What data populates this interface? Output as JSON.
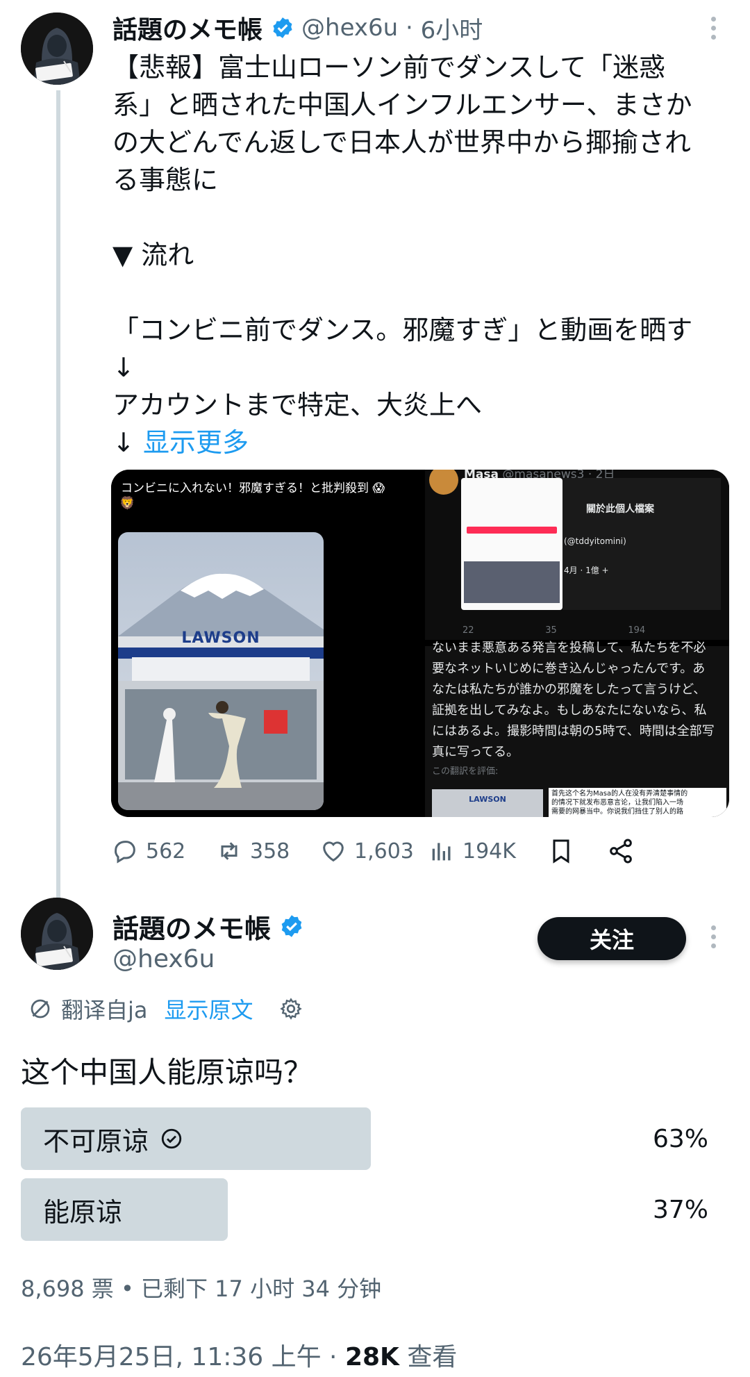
{
  "quoted_tweet": {
    "author_name": "話題のメモ帳",
    "handle": "@hex6u",
    "time_ago": "6小时",
    "text_lines": [
      "【悲報】富士山ローソン前でダンスして「迷惑",
      "系」と晒された中国人インフルエンサー、まさか",
      "の大どんでん返しで日本人が世界中から揶揄され",
      "る事態に"
    ],
    "flow_heading": "▼ 流れ",
    "flow_lines": [
      "「コンビニ前でダンス。邪魔すぎ」と動画を晒す",
      "↓",
      "アカウントまで特定、大炎上へ"
    ],
    "show_more_arrow": "↓",
    "show_more": "显示更多",
    "media": {
      "left_caption": "コンビニに入れない！邪魔すぎる！と批判殺到",
      "store_sign": "LAWSON",
      "top_right_user": "Masa",
      "top_right_handle": "@masanews3 · 2日",
      "profile_title": "關於此個人檔案",
      "profile_handle": "(@tddyitomini)",
      "profile_date": "4月 · 1億 +",
      "top_right_stats": [
        "22",
        "35",
        "194"
      ],
      "bottom_right_lines": [
        "ないまま悪意ある発言を投稿して、私たちを不必",
        "要なネットいじめに巻き込んじゃったんです。あ",
        "なたは私たちが誰かの邪魔をしたって言うけど、",
        "証拠を出してみなよ。もしあなたにないなら、私",
        "にはあるよ。撮影時間は朝の5時で、時間は全部写",
        "真に写ってる。"
      ],
      "rate_translation": "この翻訳を評価:",
      "bottom_store_sign": "LAWSON",
      "chinese_note_lines": [
        "首先这个名为Masa的人在没有弄清楚事情的",
        "的情况下就发布恶意言论，让我们陷入一场",
        "需要的网暴当中。你说我们挡住了别人的路"
      ]
    },
    "actions": {
      "replies": "562",
      "reposts": "358",
      "likes": "1,603",
      "views": "194K"
    }
  },
  "main_tweet": {
    "author_name": "話題のメモ帳",
    "handle": "@hex6u",
    "follow_label": "关注",
    "translated_from": "翻译自ja",
    "show_original": "显示原文",
    "question": "这个中国人能原谅吗？",
    "poll": {
      "options": [
        {
          "label": "不可原谅",
          "percent": "63%",
          "fraction": 0.63,
          "selected": true
        },
        {
          "label": "能原谅",
          "percent": "37%",
          "fraction": 0.37,
          "selected": false
        }
      ],
      "meta": "8,698 票 • 已剩下 17 小时 34 分钟"
    },
    "timestamp": "26年5月25日, 11:36 上午 · ",
    "views_count": "28K",
    "views_label": " 查看"
  },
  "colors": {
    "accent": "#1d9bf0",
    "text": "#0f1419",
    "secondary": "#536471",
    "poll_fill": "#cfd9de"
  }
}
